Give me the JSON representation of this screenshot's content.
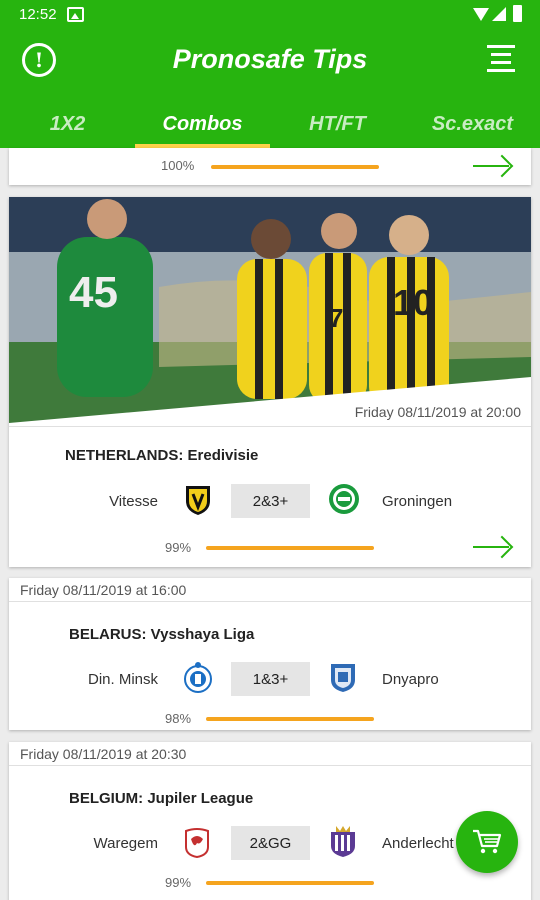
{
  "status_bar": {
    "time": "12:52"
  },
  "header": {
    "title": "Pronosafe Tips"
  },
  "tabs": [
    {
      "label": "1X2",
      "active": false
    },
    {
      "label": "Combos",
      "active": true
    },
    {
      "label": "HT/FT",
      "active": false
    },
    {
      "label": "Sc.exact",
      "active": false
    }
  ],
  "cards": [
    {
      "percent_label": "100%",
      "percent": 1.0
    },
    {
      "date": "Friday 08/11/2019 at 20:00",
      "league_country": "NETHERLANDS:",
      "league_name": "Eredivisie",
      "home": "Vitesse",
      "away": "Groningen",
      "tip": "2&3+",
      "percent_label": "99%",
      "percent": 0.99
    },
    {
      "date": "Friday 08/11/2019  at 16:00",
      "league_country": "BELARUS:",
      "league_name": "Vysshaya Liga",
      "home": "Din. Minsk",
      "away": "Dnyapro",
      "tip": "1&3+",
      "percent_label": "98%",
      "percent": 0.98
    },
    {
      "date": "Friday 08/11/2019  at 20:30",
      "league_country": "BELGIUM:",
      "league_name": "Jupiler League",
      "home": "Waregem",
      "away": "Anderlecht",
      "tip": "2&GG",
      "percent_label": "99%",
      "percent": 0.99
    }
  ],
  "colors": {
    "primary": "#27b40f",
    "accent_bar": "#f5a41e",
    "tab_indicator": "#ffd24a"
  },
  "icons": {
    "info": "info-circle-icon",
    "menu": "menu-lines-icon",
    "cart": "cart-icon",
    "arrow": "arrow-right-icon"
  }
}
